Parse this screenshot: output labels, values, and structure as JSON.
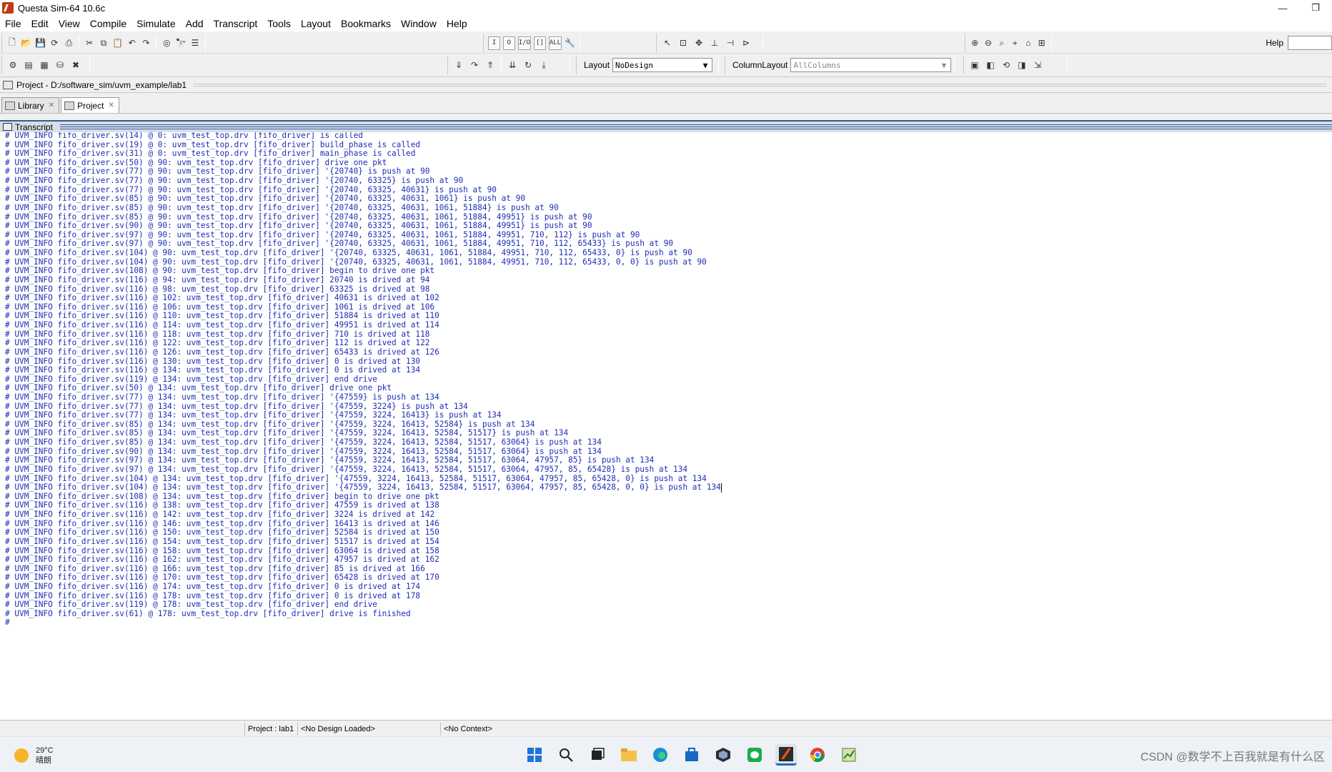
{
  "window": {
    "title": "Questa Sim-64 10.6c",
    "controls": [
      "—",
      "❐"
    ]
  },
  "menu": [
    "File",
    "Edit",
    "View",
    "Compile",
    "Simulate",
    "Add",
    "Transcript",
    "Tools",
    "Layout",
    "Bookmarks",
    "Window",
    "Help"
  ],
  "toolbar": {
    "layout_label": "Layout",
    "layout_value": "NoDesign",
    "column_layout_label": "ColumnLayout",
    "column_layout_value": "AllColumns",
    "help_label": "Help",
    "help_value": "",
    "text_buttons": [
      "I",
      "O",
      "I/O",
      "[]",
      "ALL"
    ]
  },
  "project_bar": {
    "path": "Project - D:/software_sim/uvm_example/lab1"
  },
  "tabs": [
    {
      "label": "Library"
    },
    {
      "label": "Project"
    }
  ],
  "transcript": {
    "title": "Transcript",
    "lines": [
      "# UVM_INFO fifo_driver.sv(14) @ 0: uvm_test_top.drv [fifo_driver] is called",
      "# UVM_INFO fifo_driver.sv(19) @ 0: uvm_test_top.drv [fifo_driver] build_phase is called",
      "# UVM_INFO fifo_driver.sv(31) @ 0: uvm_test_top.drv [fifo_driver] main_phase is called",
      "# UVM_INFO fifo_driver.sv(50) @ 90: uvm_test_top.drv [fifo_driver] drive one pkt",
      "# UVM_INFO fifo_driver.sv(77) @ 90: uvm_test_top.drv [fifo_driver] '{20740} is push at 90",
      "# UVM_INFO fifo_driver.sv(77) @ 90: uvm_test_top.drv [fifo_driver] '{20740, 63325} is push at 90",
      "# UVM_INFO fifo_driver.sv(77) @ 90: uvm_test_top.drv [fifo_driver] '{20740, 63325, 40631} is push at 90",
      "# UVM_INFO fifo_driver.sv(85) @ 90: uvm_test_top.drv [fifo_driver] '{20740, 63325, 40631, 1061} is push at 90",
      "# UVM_INFO fifo_driver.sv(85) @ 90: uvm_test_top.drv [fifo_driver] '{20740, 63325, 40631, 1061, 51884} is push at 90",
      "# UVM_INFO fifo_driver.sv(85) @ 90: uvm_test_top.drv [fifo_driver] '{20740, 63325, 40631, 1061, 51884, 49951} is push at 90",
      "# UVM_INFO fifo_driver.sv(90) @ 90: uvm_test_top.drv [fifo_driver] '{20740, 63325, 40631, 1061, 51884, 49951} is push at 90",
      "# UVM_INFO fifo_driver.sv(97) @ 90: uvm_test_top.drv [fifo_driver] '{20740, 63325, 40631, 1061, 51884, 49951, 710, 112} is push at 90",
      "# UVM_INFO fifo_driver.sv(97) @ 90: uvm_test_top.drv [fifo_driver] '{20740, 63325, 40631, 1061, 51884, 49951, 710, 112, 65433} is push at 90",
      "# UVM_INFO fifo_driver.sv(104) @ 90: uvm_test_top.drv [fifo_driver] '{20740, 63325, 40631, 1061, 51884, 49951, 710, 112, 65433, 0} is push at 90",
      "# UVM_INFO fifo_driver.sv(104) @ 90: uvm_test_top.drv [fifo_driver] '{20740, 63325, 40631, 1061, 51884, 49951, 710, 112, 65433, 0, 0} is push at 90",
      "# UVM_INFO fifo_driver.sv(108) @ 90: uvm_test_top.drv [fifo_driver] begin to drive one pkt",
      "# UVM_INFO fifo_driver.sv(116) @ 94: uvm_test_top.drv [fifo_driver] 20740 is drived at 94",
      "# UVM_INFO fifo_driver.sv(116) @ 98: uvm_test_top.drv [fifo_driver] 63325 is drived at 98",
      "# UVM_INFO fifo_driver.sv(116) @ 102: uvm_test_top.drv [fifo_driver] 40631 is drived at 102",
      "# UVM_INFO fifo_driver.sv(116) @ 106: uvm_test_top.drv [fifo_driver] 1061 is drived at 106",
      "# UVM_INFO fifo_driver.sv(116) @ 110: uvm_test_top.drv [fifo_driver] 51884 is drived at 110",
      "# UVM_INFO fifo_driver.sv(116) @ 114: uvm_test_top.drv [fifo_driver] 49951 is drived at 114",
      "# UVM_INFO fifo_driver.sv(116) @ 118: uvm_test_top.drv [fifo_driver] 710 is drived at 118",
      "# UVM_INFO fifo_driver.sv(116) @ 122: uvm_test_top.drv [fifo_driver] 112 is drived at 122",
      "# UVM_INFO fifo_driver.sv(116) @ 126: uvm_test_top.drv [fifo_driver] 65433 is drived at 126",
      "# UVM_INFO fifo_driver.sv(116) @ 130: uvm_test_top.drv [fifo_driver] 0 is drived at 130",
      "# UVM_INFO fifo_driver.sv(116) @ 134: uvm_test_top.drv [fifo_driver] 0 is drived at 134",
      "# UVM_INFO fifo_driver.sv(119) @ 134: uvm_test_top.drv [fifo_driver] end drive",
      "# UVM_INFO fifo_driver.sv(50) @ 134: uvm_test_top.drv [fifo_driver] drive one pkt",
      "# UVM_INFO fifo_driver.sv(77) @ 134: uvm_test_top.drv [fifo_driver] '{47559} is push at 134",
      "# UVM_INFO fifo_driver.sv(77) @ 134: uvm_test_top.drv [fifo_driver] '{47559, 3224} is push at 134",
      "# UVM_INFO fifo_driver.sv(77) @ 134: uvm_test_top.drv [fifo_driver] '{47559, 3224, 16413} is push at 134",
      "# UVM_INFO fifo_driver.sv(85) @ 134: uvm_test_top.drv [fifo_driver] '{47559, 3224, 16413, 52584} is push at 134",
      "# UVM_INFO fifo_driver.sv(85) @ 134: uvm_test_top.drv [fifo_driver] '{47559, 3224, 16413, 52584, 51517} is push at 134",
      "# UVM_INFO fifo_driver.sv(85) @ 134: uvm_test_top.drv [fifo_driver] '{47559, 3224, 16413, 52584, 51517, 63064} is push at 134",
      "# UVM_INFO fifo_driver.sv(90) @ 134: uvm_test_top.drv [fifo_driver] '{47559, 3224, 16413, 52584, 51517, 63064} is push at 134",
      "# UVM_INFO fifo_driver.sv(97) @ 134: uvm_test_top.drv [fifo_driver] '{47559, 3224, 16413, 52584, 51517, 63064, 47957, 85} is push at 134",
      "# UVM_INFO fifo_driver.sv(97) @ 134: uvm_test_top.drv [fifo_driver] '{47559, 3224, 16413, 52584, 51517, 63064, 47957, 85, 65428} is push at 134",
      "# UVM_INFO fifo_driver.sv(104) @ 134: uvm_test_top.drv [fifo_driver] '{47559, 3224, 16413, 52584, 51517, 63064, 47957, 85, 65428, 0} is push at 134",
      "# UVM_INFO fifo_driver.sv(104) @ 134: uvm_test_top.drv [fifo_driver] '{47559, 3224, 16413, 52584, 51517, 63064, 47957, 85, 65428, 0, 0} is push at 134",
      "# UVM_INFO fifo_driver.sv(108) @ 134: uvm_test_top.drv [fifo_driver] begin to drive one pkt",
      "# UVM_INFO fifo_driver.sv(116) @ 138: uvm_test_top.drv [fifo_driver] 47559 is drived at 138",
      "# UVM_INFO fifo_driver.sv(116) @ 142: uvm_test_top.drv [fifo_driver] 3224 is drived at 142",
      "# UVM_INFO fifo_driver.sv(116) @ 146: uvm_test_top.drv [fifo_driver] 16413 is drived at 146",
      "# UVM_INFO fifo_driver.sv(116) @ 150: uvm_test_top.drv [fifo_driver] 52584 is drived at 150",
      "# UVM_INFO fifo_driver.sv(116) @ 154: uvm_test_top.drv [fifo_driver] 51517 is drived at 154",
      "# UVM_INFO fifo_driver.sv(116) @ 158: uvm_test_top.drv [fifo_driver] 63064 is drived at 158",
      "# UVM_INFO fifo_driver.sv(116) @ 162: uvm_test_top.drv [fifo_driver] 47957 is drived at 162",
      "# UVM_INFO fifo_driver.sv(116) @ 166: uvm_test_top.drv [fifo_driver] 85 is drived at 166",
      "# UVM_INFO fifo_driver.sv(116) @ 170: uvm_test_top.drv [fifo_driver] 65428 is drived at 170",
      "# UVM_INFO fifo_driver.sv(116) @ 174: uvm_test_top.drv [fifo_driver] 0 is drived at 174",
      "# UVM_INFO fifo_driver.sv(116) @ 178: uvm_test_top.drv [fifo_driver] 0 is drived at 178",
      "# UVM_INFO fifo_driver.sv(119) @ 178: uvm_test_top.drv [fifo_driver] end drive",
      "# UVM_INFO fifo_driver.sv(61) @ 178: uvm_test_top.drv [fifo_driver] drive is finished",
      "#"
    ],
    "caret_line": 39
  },
  "status": {
    "project": "Project : lab1",
    "design": "<No Design Loaded>",
    "context": "<No Context>"
  },
  "taskbar": {
    "temperature": "29°C",
    "weather": "晴朗",
    "watermark": "CSDN @数学不上百我就是有什么区"
  },
  "colors": {
    "transcript_text": "#1d2fb5",
    "header_accent": "#2f5d9a",
    "app_icon": "#c23a12"
  }
}
